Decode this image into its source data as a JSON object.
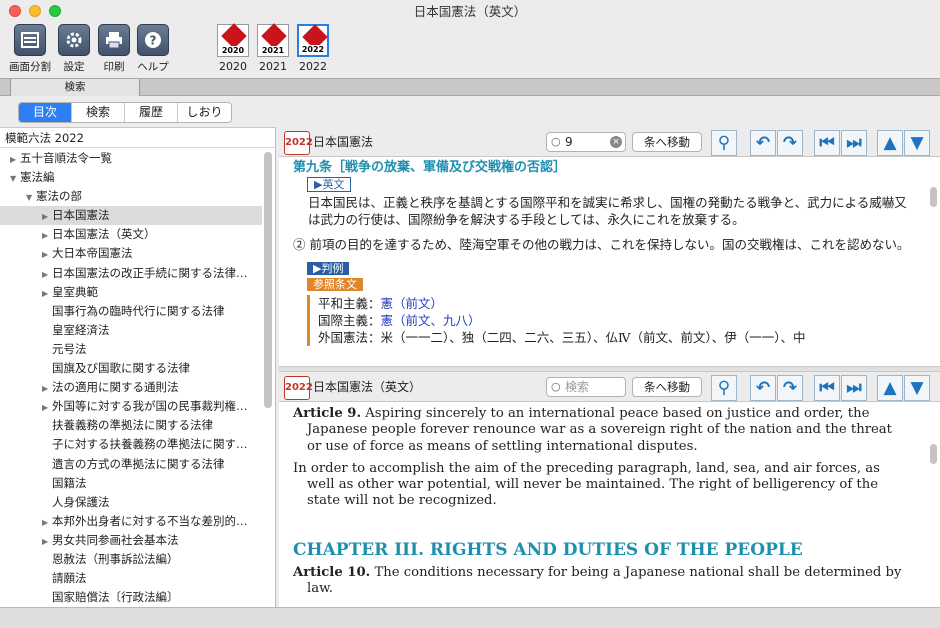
{
  "window": {
    "title": "日本国憲法（英文）"
  },
  "toolbar": {
    "buttons": [
      {
        "label": "画面分割",
        "icon": "split-view-icon"
      },
      {
        "label": "設定",
        "icon": "gear-icon"
      },
      {
        "label": "印刷",
        "icon": "printer-icon"
      },
      {
        "label": "ヘルプ",
        "icon": "help-icon"
      }
    ],
    "books": [
      {
        "year": "2020",
        "cover_text": "2020"
      },
      {
        "year": "2021",
        "cover_text": "2021"
      },
      {
        "year": "2022",
        "cover_text": "2022",
        "selected": true
      }
    ]
  },
  "search_strip": {
    "tab_label": "検索"
  },
  "segments": [
    "目次",
    "検索",
    "履歴",
    "しおり"
  ],
  "sidebar": {
    "header": "模範六法 2022",
    "items": [
      {
        "label": "五十音順法令一覧",
        "arrow": "▶",
        "level": 0
      },
      {
        "label": "憲法編",
        "arrow": "▼",
        "level": 0
      },
      {
        "label": "憲法の部",
        "arrow": "▼",
        "level": 1
      },
      {
        "label": "日本国憲法",
        "arrow": "▶",
        "level": 2,
        "selected": true
      },
      {
        "label": "日本国憲法（英文）",
        "arrow": "▶",
        "level": 2
      },
      {
        "label": "大日本帝国憲法",
        "arrow": "▶",
        "level": 2
      },
      {
        "label": "日本国憲法の改正手続に関する法律…",
        "arrow": "▶",
        "level": 2
      },
      {
        "label": "皇室典範",
        "arrow": "▶",
        "level": 2
      },
      {
        "label": "国事行為の臨時代行に関する法律",
        "arrow": "",
        "level": 2
      },
      {
        "label": "皇室経済法",
        "arrow": "",
        "level": 2
      },
      {
        "label": "元号法",
        "arrow": "",
        "level": 2
      },
      {
        "label": "国旗及び国歌に関する法律",
        "arrow": "",
        "level": 2
      },
      {
        "label": "法の適用に関する通則法",
        "arrow": "▶",
        "level": 2
      },
      {
        "label": "外国等に対する我が国の民事裁判権…",
        "arrow": "▶",
        "level": 2
      },
      {
        "label": "扶養義務の準拠法に関する法律",
        "arrow": "",
        "level": 2
      },
      {
        "label": "子に対する扶養義務の準拠法に関す…",
        "arrow": "",
        "level": 2
      },
      {
        "label": "遺言の方式の準拠法に関する法律",
        "arrow": "",
        "level": 2
      },
      {
        "label": "国籍法",
        "arrow": "",
        "level": 2
      },
      {
        "label": "人身保護法",
        "arrow": "",
        "level": 2
      },
      {
        "label": "本邦外出身者に対する不当な差別的…",
        "arrow": "▶",
        "level": 2
      },
      {
        "label": "男女共同参画社会基本法",
        "arrow": "▶",
        "level": 2
      },
      {
        "label": "恩赦法（刑事訴訟法編）",
        "arrow": "",
        "level": 2
      },
      {
        "label": "請願法",
        "arrow": "",
        "level": 2
      },
      {
        "label": "国家賠償法〔行政法編〕",
        "arrow": "",
        "level": 2
      }
    ]
  },
  "pane_top": {
    "badge": "2022",
    "title": "日本国憲法",
    "search_value": "9",
    "jump_label": "条へ移動",
    "article_heading": "第九条［戦争の放棄、軍備及び交戦権の否認］",
    "en_tag": "▶英文",
    "para1": "日本国民は、正義と秩序を基調とする国際平和を誠実に希求し、国権の発動たる戦争と、武力による威嚇又は武力の行使は、国際紛争を解決する手段としては、永久にこれを放棄する。",
    "para2": "② 前項の目的を達するため、陸海空軍その他の戦力は、これを保持しない。国の交戦権は、これを認めない。",
    "case_tag": "▶判例",
    "ref_tag": "参照条文",
    "refs": [
      {
        "label": "平和主義：",
        "links": "憲（前文）"
      },
      {
        "label": "国際主義：",
        "links": "憲（前文、九八）"
      },
      {
        "label": "外国憲法：",
        "links": "米（一一二）、独（二四、二六、三五）、仏Ⅳ（前文、前文）、伊（一一）、中"
      }
    ]
  },
  "pane_bottom": {
    "badge": "2022",
    "title": "日本国憲法（英文）",
    "search_placeholder": "検索",
    "jump_label": "条へ移動",
    "art9_label": "Article 9.",
    "art9_text": "Aspiring sincerely to an international peace based on justice and order, the Japanese people forever renounce war as a sovereign right of the nation and the threat or use of force as means of settling international disputes.",
    "art9_para2": "In order to accomplish the aim of the preceding paragraph, land, sea, and air forces, as well as other war potential, will never be maintained. The right of belligerency of the state will not be recognized.",
    "chapter": "CHAPTER III. RIGHTS AND DUTIES OF THE PEOPLE",
    "art10_label": "Article 10.",
    "art10_text": "The conditions necessary for being a Japanese national shall be determined by law."
  },
  "nav_icons": [
    "search-icon",
    "back-icon",
    "forward-icon",
    "prev-article-icon",
    "next-article-icon",
    "scroll-up-icon",
    "scroll-down-icon"
  ]
}
